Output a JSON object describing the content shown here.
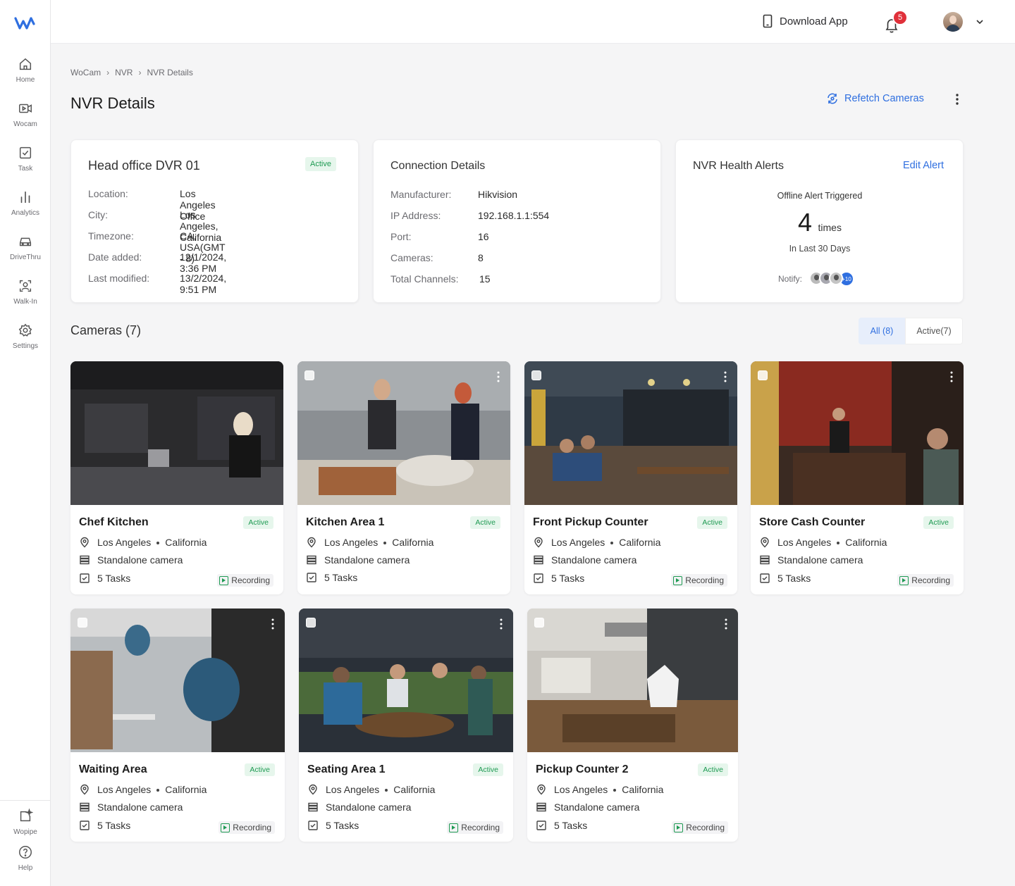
{
  "nav": {
    "items": [
      {
        "label": "Home",
        "icon": "home-icon"
      },
      {
        "label": "Wocam",
        "icon": "video-camera-icon"
      },
      {
        "label": "Task",
        "icon": "task-check-icon"
      },
      {
        "label": "Analytics",
        "icon": "bar-chart-icon"
      },
      {
        "label": "DriveThru",
        "icon": "car-icon"
      },
      {
        "label": "Walk-In",
        "icon": "person-scan-icon"
      },
      {
        "label": "Settings",
        "icon": "gear-icon"
      }
    ],
    "bottom": [
      {
        "label": "Wopipe",
        "icon": "sparkle-chat-icon"
      },
      {
        "label": "Help",
        "icon": "help-icon"
      }
    ]
  },
  "topbar": {
    "download_label": "Download App",
    "notification_count": "5"
  },
  "breadcrumb": [
    "WoCam",
    "NVR",
    "NVR Details"
  ],
  "page": {
    "title": "NVR Details",
    "refetch_label": "Refetch Cameras"
  },
  "device": {
    "name": "Head office DVR 01",
    "status": "Active",
    "fields": [
      {
        "key": "Location:",
        "value": "Los Angeles Office"
      },
      {
        "key": "City:",
        "value": "Los Angeles, California"
      },
      {
        "key": "Timezone:",
        "value": "CA, USA(GMT - 8)"
      },
      {
        "key": "Date added:",
        "value": "12/1/2024, 3:36 PM"
      },
      {
        "key": "Last modified:",
        "value": "13/2/2024, 9:51 PM"
      }
    ]
  },
  "connection": {
    "title": "Connection Details",
    "fields": [
      {
        "key": "Manufacturer:",
        "value": "Hikvision"
      },
      {
        "key": "IP Address:",
        "value": "192.168.1.1:554"
      },
      {
        "key": "Port:",
        "value": "16"
      },
      {
        "key": "Cameras:",
        "value": "8"
      },
      {
        "key": "Total Channels:",
        "value": "15"
      }
    ]
  },
  "alerts": {
    "title": "NVR Health Alerts",
    "edit_label": "Edit Alert",
    "caption": "Offline Alert Triggered",
    "count": "4",
    "unit": "times",
    "period": "In Last 30 Days",
    "notify_label": "Notify:",
    "more_count": "+10"
  },
  "cameras": {
    "heading": "Cameras (7)",
    "filter_all": "All (8)",
    "filter_active": "Active(7)",
    "status_label": "Active",
    "city": "Los Angeles",
    "state": "California",
    "type": "Standalone camera",
    "tasks": "5 Tasks",
    "recording_label": "Recording",
    "items": [
      {
        "name": "Chef Kitchen"
      },
      {
        "name": "Kitchen Area 1"
      },
      {
        "name": "Front Pickup Counter"
      },
      {
        "name": "Store Cash Counter"
      },
      {
        "name": "Waiting Area"
      },
      {
        "name": "Seating Area 1"
      },
      {
        "name": "Pickup Counter 2"
      }
    ]
  },
  "colors": {
    "accent": "#2f6fe0",
    "active_green": "#1e9a52",
    "badge_red": "#e0303a"
  }
}
